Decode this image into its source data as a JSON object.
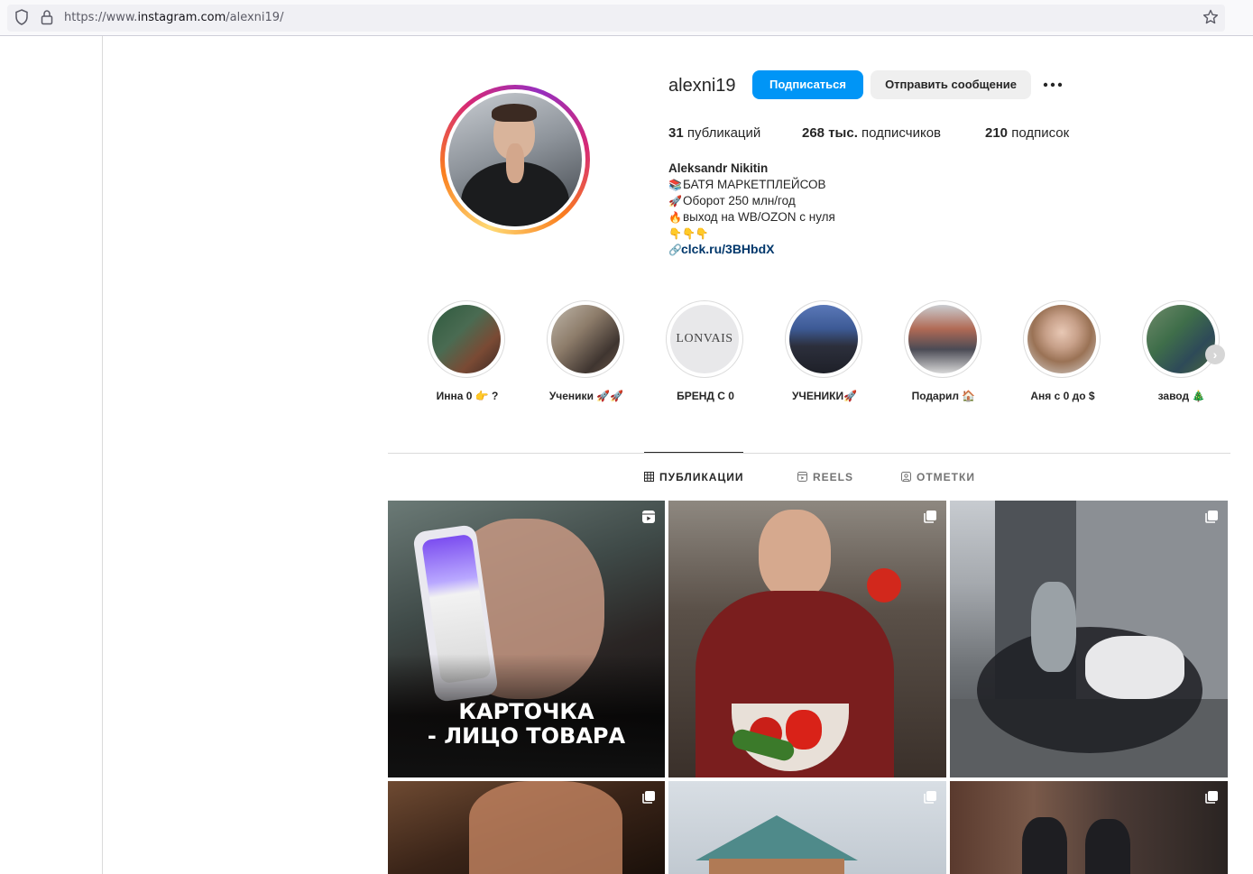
{
  "browser": {
    "url_prefix": "https://www.",
    "url_domain": "instagram.com",
    "url_path": "/alexni19/"
  },
  "profile": {
    "username": "alexni19",
    "follow_label": "Подписаться",
    "message_label": "Отправить сообщение",
    "stats": {
      "posts_count": "31",
      "posts_label": "публикаций",
      "followers_count": "268 тыс.",
      "followers_label": "подписчиков",
      "following_count": "210",
      "following_label": "подписок"
    },
    "bio": {
      "name": "Aleksandr Nikitin",
      "line1_emoji": "📚",
      "line1": "БАТЯ МАРКЕТПЛЕЙСОВ",
      "line2_emoji": "🚀",
      "line2": "Оборот 250 млн/год",
      "line3_emoji": "🔥",
      "line3": "выход на WB/OZON с нуля",
      "line4": "👇👇👇",
      "link": "clck.ru/3BHbdX"
    }
  },
  "highlights": [
    {
      "label": "Инна 0 👉 ?"
    },
    {
      "label": "Ученики 🚀🚀"
    },
    {
      "label": "БРЕНД С 0",
      "logo_text": "LONVAIS"
    },
    {
      "label": "УЧЕНИКИ🚀"
    },
    {
      "label": "Подарил 🏠"
    },
    {
      "label": "Аня с 0 до $"
    },
    {
      "label": "завод 🎄"
    }
  ],
  "tabs": {
    "posts": "ПУБЛИКАЦИИ",
    "reels": "REELS",
    "tagged": "ОТМЕТКИ"
  },
  "posts": [
    {
      "caption_line1": "КАРТОЧКА",
      "caption_line2": "- ЛИЦО ТОВАРА",
      "icon": "reel-icon"
    },
    {
      "icon": "carousel-icon"
    },
    {
      "icon": "carousel-icon"
    },
    {
      "icon": "carousel-icon"
    },
    {
      "icon": "carousel-icon"
    },
    {
      "icon": "carousel-icon"
    }
  ],
  "colors": {
    "accent": "#0095f6",
    "link": "#00376b",
    "text": "#262626",
    "divider": "#dbdbdb"
  }
}
